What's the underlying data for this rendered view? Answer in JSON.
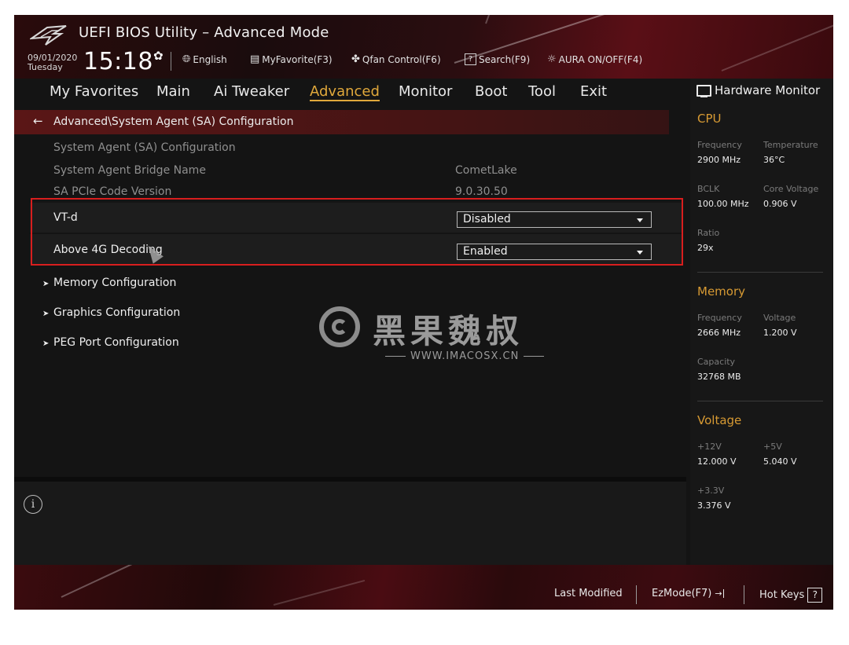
{
  "header": {
    "title": "UEFI BIOS Utility – Advanced Mode",
    "date": "09/01/2020",
    "weekday": "Tuesday",
    "time": "15:18",
    "toolbar": {
      "language": "English",
      "favorite": "MyFavorite(F3)",
      "qfan": "Qfan Control(F6)",
      "search": "Search(F9)",
      "aura": "AURA ON/OFF(F4)"
    }
  },
  "nav": {
    "tabs": [
      "My Favorites",
      "Main",
      "Ai Tweaker",
      "Advanced",
      "Monitor",
      "Boot",
      "Tool",
      "Exit"
    ],
    "active": "Advanced"
  },
  "breadcrumb": "Advanced\\System Agent (SA) Configuration",
  "settings": {
    "heading": "System Agent (SA) Configuration",
    "bridge_label": "System Agent Bridge Name",
    "bridge_value": "CometLake",
    "pcie_label": "SA PCIe Code Version",
    "pcie_value": "9.0.30.50",
    "vtd_label": "VT-d",
    "vtd_value": "Disabled",
    "above4g_label": "Above 4G Decoding",
    "above4g_value": "Enabled",
    "submenus": [
      "Memory Configuration",
      "Graphics Configuration",
      "PEG Port Configuration"
    ]
  },
  "watermark": {
    "text": "黑果魏叔",
    "url": "WWW.IMACOSX.CN"
  },
  "hardware_monitor": {
    "title": "Hardware Monitor",
    "cpu": {
      "title": "CPU",
      "frequency_label": "Frequency",
      "frequency": "2900 MHz",
      "temperature_label": "Temperature",
      "temperature": "36°C",
      "bclk_label": "BCLK",
      "bclk": "100.00 MHz",
      "core_voltage_label": "Core Voltage",
      "core_voltage": "0.906 V",
      "ratio_label": "Ratio",
      "ratio": "29x"
    },
    "memory": {
      "title": "Memory",
      "frequency_label": "Frequency",
      "frequency": "2666 MHz",
      "voltage_label": "Voltage",
      "voltage": "1.200 V",
      "capacity_label": "Capacity",
      "capacity": "32768 MB"
    },
    "voltage": {
      "title": "Voltage",
      "v12_label": "+12V",
      "v12": "12.000 V",
      "v5_label": "+5V",
      "v5": "5.040 V",
      "v33_label": "+3.3V",
      "v33": "3.376 V"
    }
  },
  "footer": {
    "last_modified": "Last Modified",
    "ezmode": "EzMode(F7)",
    "hotkeys": "Hot Keys",
    "hotkeys_icon": "?"
  },
  "colors": {
    "accent_orange": "#e0a83b",
    "highlight_red": "#d81e1e",
    "breadcrumb_red": "#5a1616"
  }
}
